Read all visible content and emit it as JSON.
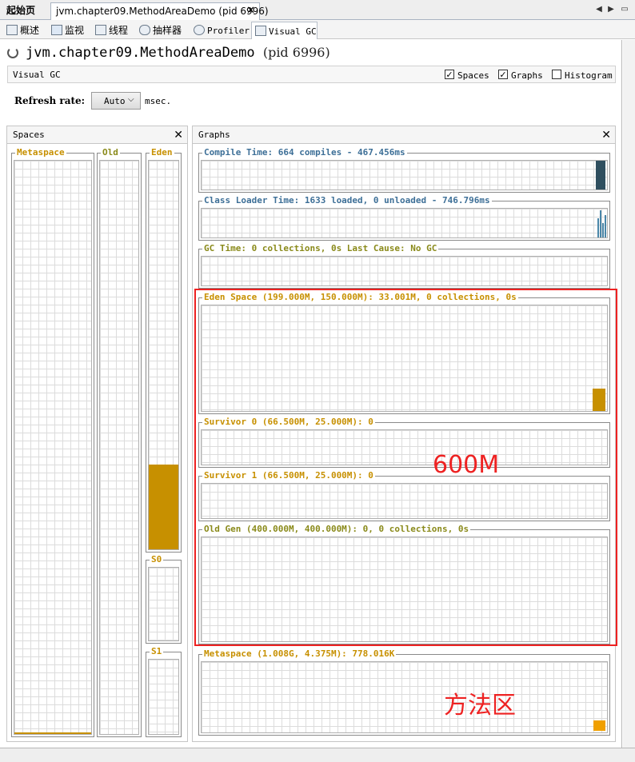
{
  "doc_tabs": {
    "start_page": "起始页",
    "active": "jvm.chapter09.MethodAreaDemo (pid 6996)"
  },
  "sub_tabs": [
    {
      "label": "概述",
      "icon": "overview-icon"
    },
    {
      "label": "监视",
      "icon": "monitor-icon"
    },
    {
      "label": "线程",
      "icon": "threads-icon"
    },
    {
      "label": "抽样器",
      "icon": "sampler-icon"
    },
    {
      "label": "Profiler",
      "icon": "profiler-icon"
    },
    {
      "label": "Visual GC",
      "icon": "visual-gc-icon"
    }
  ],
  "title": {
    "name": "jvm.chapter09.MethodAreaDemo",
    "pid": "(pid 6996)"
  },
  "visual_gc_bar": {
    "label": "Visual GC",
    "options": [
      {
        "label": "Spaces",
        "checked": true
      },
      {
        "label": "Graphs",
        "checked": true
      },
      {
        "label": "Histogram",
        "checked": false
      }
    ]
  },
  "refresh": {
    "label": "Refresh rate:",
    "value": "Auto",
    "unit": "msec."
  },
  "spaces_panel": {
    "title": "Spaces",
    "metaspace": "Metaspace",
    "old": "Old",
    "eden": "Eden",
    "s0": "S0",
    "s1": "S1"
  },
  "graphs_panel": {
    "title": "Graphs",
    "compile": "Compile Time: 664 compiles - 467.456ms",
    "classloader": "Class Loader Time: 1633 loaded, 0 unloaded - 746.796ms",
    "gc": "GC Time: 0 collections, 0s Last Cause: No GC",
    "eden": "Eden Space (199.000M, 150.000M): 33.001M, 0 collections, 0s",
    "survivor0": "Survivor 0 (66.500M, 25.000M): 0",
    "survivor1": "Survivor 1 (66.500M, 25.000M): 0",
    "oldgen": "Old Gen (400.000M, 400.000M): 0, 0 collections, 0s",
    "metaspace": "Metaspace (1.008G, 4.375M): 778.016K"
  },
  "annotations": {
    "heap": "600M",
    "method_area": "方法区"
  },
  "colors": {
    "gold": "#c79000",
    "olive": "#8a8a1a",
    "blue": "#3d6f97",
    "red": "#ee2222"
  }
}
